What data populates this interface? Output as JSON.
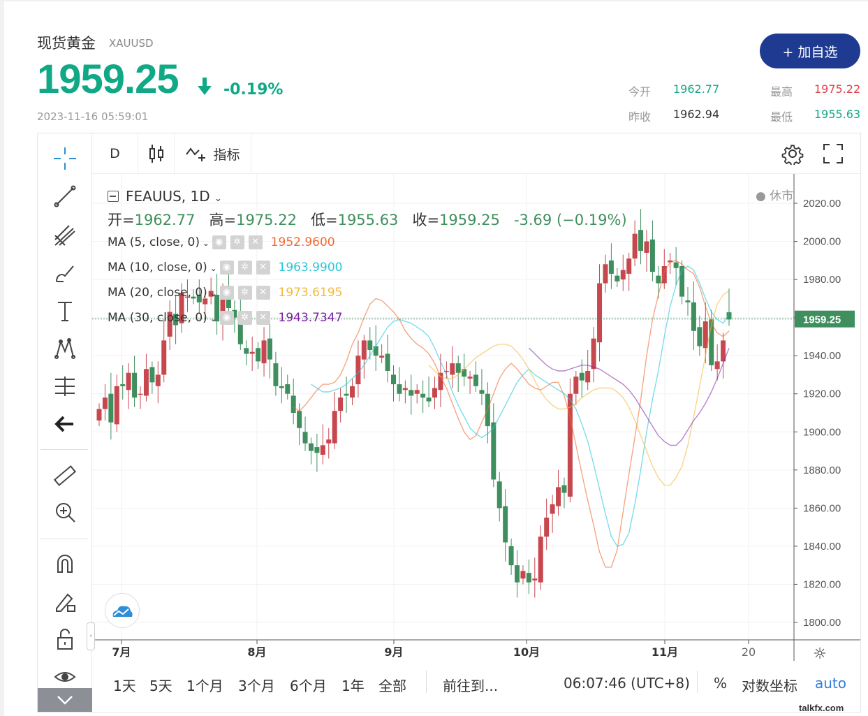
{
  "header": {
    "name": "现货黄金",
    "code": "XAUUSD",
    "price": "1959.25",
    "change_pct": "-0.19%",
    "timestamp": "2023-11-16 05:59:01",
    "add_button": "+ 加自选"
  },
  "quote": {
    "open_label": "今开",
    "open": "1962.77",
    "high_label": "最高",
    "high": "1975.22",
    "prev_label": "昨收",
    "prev": "1962.94",
    "low_label": "最低",
    "low": "1955.63"
  },
  "colors": {
    "up": "#c7474f",
    "down": "#3f8f5e",
    "accent": "#1f3b91",
    "green_text": "#11a886",
    "red_text": "#e0414b"
  },
  "toolbar": {
    "interval": "D",
    "indicators_label": "指标"
  },
  "legend": {
    "symbol": "FEAUUS, 1D",
    "market_status": "● 休市",
    "ohlc": {
      "o_label": "开=",
      "o": "1962.77",
      "h_label": "高=",
      "h": "1975.22",
      "l_label": "低=",
      "l": "1955.63",
      "c_label": "收=",
      "c": "1959.25",
      "chg": "-3.69 (−0.19%)"
    },
    "ma": [
      {
        "label": "MA (5, close, 0)",
        "value": "1952.9600",
        "color": "#f06a32"
      },
      {
        "label": "MA (10, close, 0)",
        "value": "1963.9900",
        "color": "#26c6da"
      },
      {
        "label": "MA (20, close, 0)",
        "value": "1973.6195",
        "color": "#f3b93d"
      },
      {
        "label": "MA (30, close, 0)",
        "value": "1943.7347",
        "color": "#7b1fa2"
      }
    ]
  },
  "ranges": [
    "1天",
    "5天",
    "1个月",
    "3个月",
    "6个月",
    "1年",
    "全部"
  ],
  "goto_label": "前往到...",
  "clock": "06:07:46 (UTC+8)",
  "percent_label": "%",
  "log_label": "对数坐标",
  "auto_label": "auto",
  "watermark": "talkfx.com",
  "chart_data": {
    "type": "candlestick",
    "y_ticks": [
      "2020.00",
      "2000.00",
      "1980.00",
      "1960.00",
      "1940.00",
      "1920.00",
      "1900.00",
      "1880.00",
      "1860.00",
      "1840.00",
      "1820.00",
      "1800.00"
    ],
    "x_ticks": [
      "7月",
      "8月",
      "9月",
      "10月",
      "11月",
      "20"
    ],
    "last_price_label": "1959.25",
    "ylim": [
      1793,
      2030
    ],
    "closes": [
      1912,
      1918,
      1905,
      1924,
      1924,
      1931,
      1918,
      1920,
      1933,
      1926,
      1930,
      1948,
      1963,
      1956,
      1973,
      1971,
      1970,
      1968,
      1970,
      1974,
      1958,
      1972,
      1965,
      1960,
      1946,
      1941,
      1942,
      1937,
      1948,
      1938,
      1924,
      1923,
      1920,
      1910,
      1902,
      1894,
      1890,
      1889,
      1893,
      1896,
      1911,
      1918,
      1919,
      1924,
      1940,
      1948,
      1943,
      1940,
      1940,
      1932,
      1925,
      1920,
      1923,
      1919,
      1922,
      1918,
      1916,
      1923,
      1931,
      1932,
      1936,
      1931,
      1929,
      1929,
      1924,
      1920,
      1903,
      1875,
      1860,
      1842,
      1830,
      1821,
      1827,
      1821,
      1823,
      1845,
      1855,
      1862,
      1871,
      1868,
      1920,
      1929,
      1927,
      1932,
      1949,
      1978,
      1988,
      1983,
      1979,
      1985,
      1991,
      2004,
      1995,
      2000,
      1984,
      1978,
      1987,
      1990,
      1986,
      1971,
      1968,
      1953,
      1945,
      1958,
      1935,
      1937,
      1948,
      1959
    ],
    "ma": [
      {
        "name": "MA5",
        "values": [
          1913,
          1911,
          1914,
          1918,
          1922,
          1925,
          1925,
          1926,
          1930,
          1937,
          1946,
          1952,
          1960,
          1967,
          1970,
          1969,
          1966,
          1963,
          1959,
          1953,
          1949,
          1946,
          1944,
          1941,
          1936,
          1929,
          1923,
          1915,
          1907,
          1900,
          1896,
          1898,
          1905,
          1912,
          1920,
          1928,
          1933,
          1936,
          1933,
          1929,
          1925,
          1923,
          1922,
          1924,
          1926,
          1926,
          1919,
          1908,
          1893,
          1878,
          1864,
          1851,
          1837,
          1829,
          1829,
          1838,
          1858,
          1878,
          1897,
          1917,
          1940,
          1959,
          1972,
          1984,
          1989,
          1990,
          1988,
          1985,
          1983,
          1976,
          1966,
          1957,
          1952,
          1950,
          1953
        ]
      },
      {
        "name": "MA10",
        "values": [
          1925,
          1923,
          1921,
          1921,
          1922,
          1923,
          1925,
          1928,
          1931,
          1935,
          1940,
          1945,
          1950,
          1955,
          1958,
          1959,
          1958,
          1957,
          1955,
          1953,
          1950,
          1944,
          1937,
          1930,
          1921,
          1914,
          1908,
          1902,
          1899,
          1897,
          1899,
          1902,
          1908,
          1914,
          1920,
          1926,
          1930,
          1933,
          1930,
          1928,
          1926,
          1924,
          1922,
          1920,
          1917,
          1912,
          1904,
          1895,
          1883,
          1870,
          1857,
          1845,
          1840,
          1841,
          1847,
          1862,
          1880,
          1900,
          1917,
          1932,
          1950,
          1966,
          1977,
          1985,
          1987,
          1985,
          1978,
          1970,
          1963,
          1959,
          1957,
          1962
        ]
      },
      {
        "name": "MA20",
        "values": [
          1935,
          1932,
          1929,
          1928,
          1928,
          1930,
          1933,
          1936,
          1939,
          1941,
          1943,
          1945,
          1946,
          1946,
          1945,
          1942,
          1938,
          1933,
          1927,
          1921,
          1917,
          1914,
          1912,
          1912,
          1913,
          1915,
          1918,
          1920,
          1922,
          1923,
          1923,
          1923,
          1921,
          1918,
          1913,
          1906,
          1898,
          1890,
          1882,
          1876,
          1872,
          1872,
          1876,
          1882,
          1893,
          1908,
          1924,
          1940,
          1956,
          1967,
          1972,
          1974
        ]
      },
      {
        "name": "MA30",
        "values": [
          1944,
          1941,
          1938,
          1935,
          1933,
          1932,
          1932,
          1933,
          1934,
          1935,
          1935,
          1934,
          1933,
          1931,
          1929,
          1927,
          1925,
          1922,
          1918,
          1913,
          1908,
          1903,
          1898,
          1895,
          1893,
          1893,
          1896,
          1901,
          1906,
          1910,
          1915,
          1921,
          1928,
          1936,
          1944
        ]
      }
    ]
  }
}
